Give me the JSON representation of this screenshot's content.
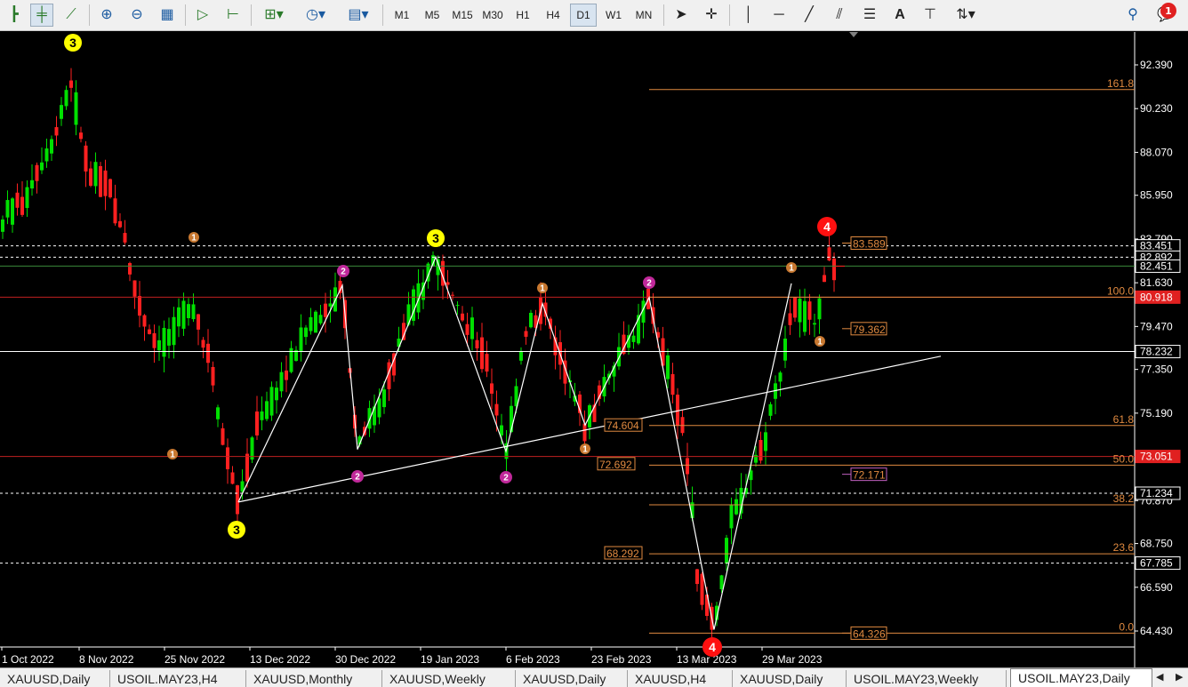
{
  "toolbar": {
    "timeframes": [
      "M1",
      "M5",
      "M15",
      "M30",
      "H1",
      "H4",
      "D1",
      "W1",
      "MN"
    ],
    "selected_timeframe": "D1",
    "text_tool": "A",
    "notifications_count": "1"
  },
  "chart": {
    "symbol": "USOIL.MAY23",
    "timeframe": "Daily",
    "colors": {
      "bull": "#00e000",
      "bear": "#ff2020",
      "fib": "#e08a40",
      "hline": "#ffffff",
      "current": "#ff2020"
    },
    "price_axis": [
      "92.390",
      "90.230",
      "88.070",
      "85.950",
      "83.790",
      "81.630",
      "79.470",
      "77.350",
      "75.190",
      "70.870",
      "68.750",
      "66.590",
      "64.430"
    ],
    "price_tags": [
      {
        "text": "83.451",
        "style": "white"
      },
      {
        "text": "82.892",
        "style": "white"
      },
      {
        "text": "82.451",
        "style": "white"
      },
      {
        "text": "80.918",
        "style": "red"
      },
      {
        "text": "78.232",
        "style": "white"
      },
      {
        "text": "73.051",
        "style": "red"
      },
      {
        "text": "71.234",
        "style": "white"
      },
      {
        "text": "67.785",
        "style": "white"
      }
    ],
    "date_axis": [
      "1 Oct 2022",
      "8 Nov 2022",
      "25 Nov 2022",
      "13 Dec 2022",
      "30 Dec 2022",
      "19 Jan 2023",
      "6 Feb 2023",
      "23 Feb 2023",
      "13 Mar 2023",
      "29 Mar 2023"
    ],
    "fib_levels": [
      {
        "level": "161.8"
      },
      {
        "level": "100.0"
      },
      {
        "level": "61.8"
      },
      {
        "level": "50.0"
      },
      {
        "level": "38.2"
      },
      {
        "level": "23.6"
      },
      {
        "level": "0.0"
      }
    ],
    "fib_price_boxes": [
      "74.604",
      "72.692",
      "68.292"
    ],
    "right_boxes": [
      "83.589",
      "79.362",
      "72.171",
      "64.326"
    ],
    "wave_labels": [
      {
        "text": "3",
        "style": "yellow"
      },
      {
        "text": "3",
        "style": "yellow"
      },
      {
        "text": "3",
        "style": "yellow"
      },
      {
        "text": "4",
        "style": "red"
      },
      {
        "text": "4",
        "style": "red"
      },
      {
        "text": "2",
        "style": "magenta"
      },
      {
        "text": "2",
        "style": "magenta"
      },
      {
        "text": "2",
        "style": "magenta"
      },
      {
        "text": "2",
        "style": "magenta"
      },
      {
        "text": "1",
        "style": "orange"
      },
      {
        "text": "1",
        "style": "orange"
      },
      {
        "text": "1",
        "style": "orange"
      },
      {
        "text": "1",
        "style": "orange"
      },
      {
        "text": "1",
        "style": "orange"
      },
      {
        "text": "1",
        "style": "orange"
      }
    ]
  },
  "tabs": [
    {
      "label": "XAUUSD,Daily",
      "active": false
    },
    {
      "label": "USOIL.MAY23,H4",
      "active": false
    },
    {
      "label": "XAUUSD,Monthly",
      "active": false
    },
    {
      "label": "XAUUSD,Weekly",
      "active": false
    },
    {
      "label": "XAUUSD,Daily",
      "active": false
    },
    {
      "label": "XAUUSD,H4",
      "active": false
    },
    {
      "label": "XAUUSD,Daily",
      "active": false
    },
    {
      "label": "USOIL.MAY23,Weekly",
      "active": false
    },
    {
      "label": "USOIL.MAY23,Daily",
      "active": true
    }
  ]
}
